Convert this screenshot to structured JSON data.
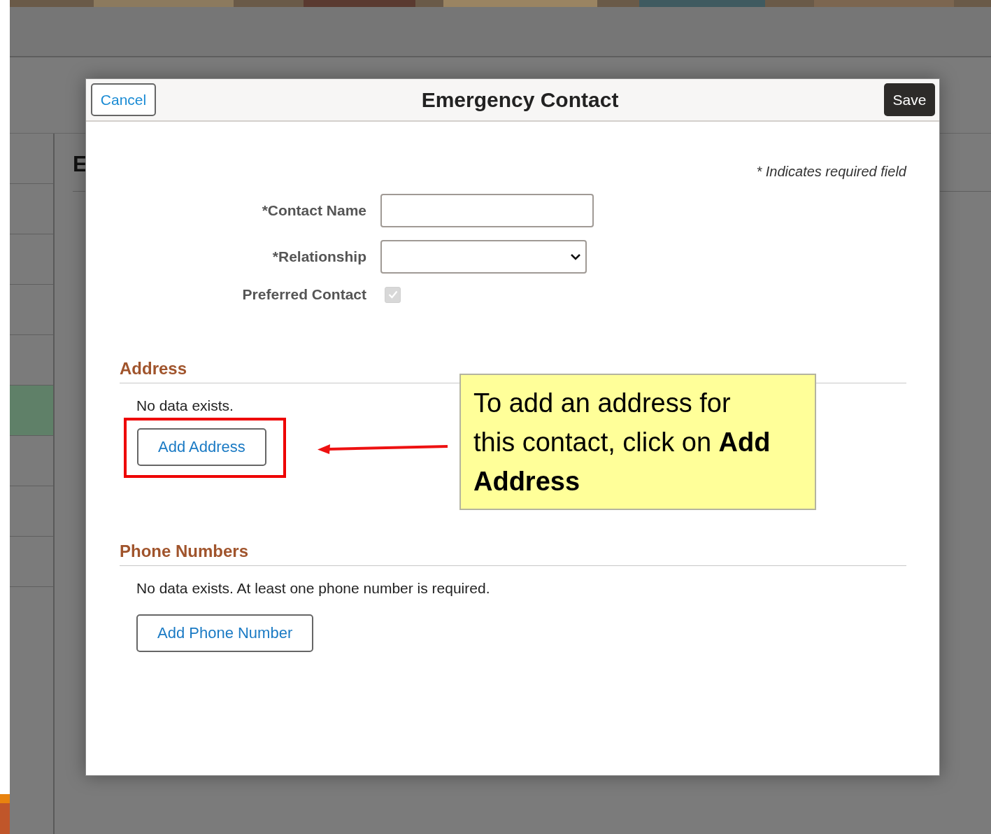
{
  "background": {
    "heading": "E",
    "sidebar_rows": [
      {
        "selected": false
      },
      {
        "selected": false
      },
      {
        "selected": false
      },
      {
        "selected": false
      },
      {
        "selected": false
      },
      {
        "selected": true
      },
      {
        "selected": false
      },
      {
        "selected": false
      },
      {
        "selected": false
      }
    ]
  },
  "modal": {
    "title": "Emergency Contact",
    "cancel": "Cancel",
    "save": "Save",
    "required_note": "* Indicates required field",
    "fields": [
      {
        "kind": "text",
        "label": "*Contact Name"
      },
      {
        "kind": "select",
        "label": "*Relationship"
      },
      {
        "kind": "checkbox",
        "label": "Preferred Contact",
        "checked": true,
        "disabled": true
      }
    ],
    "sections": [
      {
        "title": "Address",
        "message": "No data exists.",
        "button": "Add Address",
        "highlighted": true
      },
      {
        "title": "Phone Numbers",
        "message": "No data exists. At least one phone number is required.",
        "button": "Add Phone Number",
        "highlighted": false
      }
    ]
  },
  "callout": {
    "text": "To add an address for this contact, click on **Add Address**"
  }
}
